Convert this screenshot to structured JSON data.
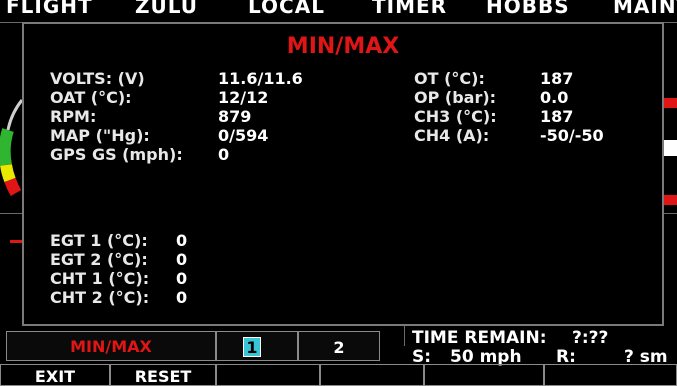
{
  "top_tabs": [
    "FLIGHT",
    "ZULU",
    "LOCAL",
    "TIMER",
    "HOBBS",
    "MAINT"
  ],
  "modal": {
    "title": "MIN/MAX",
    "left_rows": [
      {
        "label": "VOLTS: (V)",
        "value": "11.6/11.6"
      },
      {
        "label": "OAT (°C):",
        "value": "12/12"
      },
      {
        "label": "RPM:",
        "value": "879"
      },
      {
        "label": "MAP (\"Hg):",
        "value": "0/594"
      },
      {
        "label": "GPS GS (mph):",
        "value": "0"
      }
    ],
    "right_rows": [
      {
        "label": "OT (°C):",
        "value": "187"
      },
      {
        "label": "OP (bar):",
        "value": "0.0"
      },
      {
        "label": "CH3 (°C):",
        "value": "187"
      },
      {
        "label": "CH4 (A):",
        "value": "-50/-50"
      }
    ],
    "egt_rows": [
      {
        "label": "EGT 1 (°C):",
        "value": "0"
      },
      {
        "label": "EGT 2 (°C):",
        "value": "0"
      },
      {
        "label": "CHT 1 (°C):",
        "value": "0"
      },
      {
        "label": "CHT 2 (°C):",
        "value": "0"
      }
    ]
  },
  "bottom": {
    "mode_label": "MIN/MAX",
    "page1": "1",
    "page2": "2",
    "time_remain_label": "TIME REMAIN:",
    "time_remain_value": "?:??",
    "s_label": "S:",
    "s_value": "50 mph",
    "r_label": "R:",
    "r_value": "? sm"
  },
  "softkeys": [
    "EXIT",
    "RESET",
    "",
    "",
    "",
    ""
  ],
  "colors": {
    "title": "#e01515",
    "page_selected": "#39c5d6",
    "gauge_green": "#2fb52f",
    "gauge_yellow": "#e8e800",
    "gauge_red": "#e01515"
  }
}
